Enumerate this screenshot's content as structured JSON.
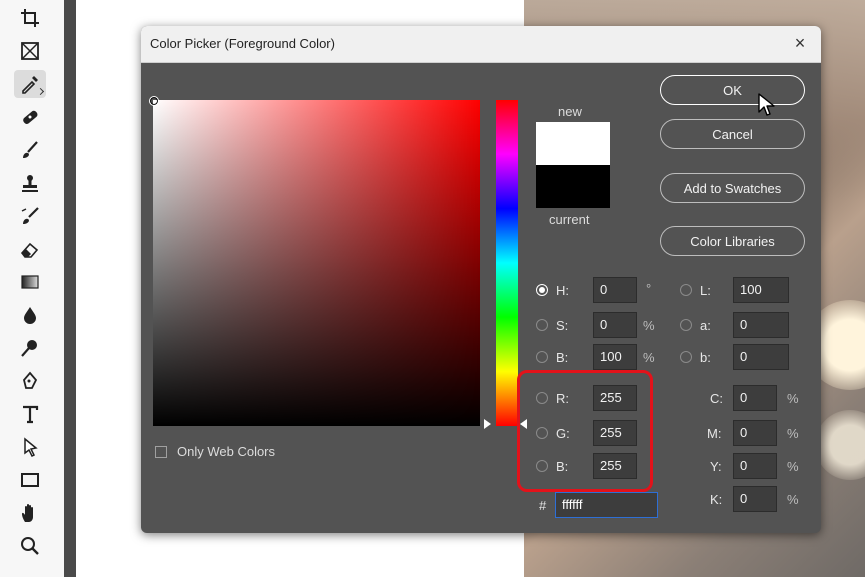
{
  "dialog": {
    "title": "Color Picker (Foreground Color)",
    "close": "×"
  },
  "swatches": {
    "new_label": "new",
    "current_label": "current",
    "new_color": "#ffffff",
    "current_color": "#000000"
  },
  "buttons": {
    "ok": "OK",
    "cancel": "Cancel",
    "add_to_swatches": "Add to Swatches",
    "color_libraries": "Color Libraries"
  },
  "hsb": {
    "h_label": "H:",
    "h_value": "0",
    "h_unit": "°",
    "s_label": "S:",
    "s_value": "0",
    "s_unit": "%",
    "b_label": "B:",
    "b_value": "100",
    "b_unit": "%"
  },
  "lab": {
    "l_label": "L:",
    "l_value": "100",
    "a_label": "a:",
    "a_value": "0",
    "b_label": "b:",
    "b_value": "0"
  },
  "rgb": {
    "r_label": "R:",
    "r_value": "255",
    "g_label": "G:",
    "g_value": "255",
    "b_label": "B:",
    "b_value": "255"
  },
  "cmyk": {
    "c_label": "C:",
    "c_value": "0",
    "c_unit": "%",
    "m_label": "M:",
    "m_value": "0",
    "m_unit": "%",
    "y_label": "Y:",
    "y_value": "0",
    "y_unit": "%",
    "k_label": "K:",
    "k_value": "0",
    "k_unit": "%"
  },
  "hex": {
    "label": "#",
    "value": "ffffff"
  },
  "web_colors": {
    "label": "Only Web Colors"
  },
  "toolbar": {
    "tools": [
      "crop-icon",
      "frame-icon",
      "eyedropper-icon",
      "healing-brush-icon",
      "brush-icon",
      "clone-stamp-icon",
      "history-brush-icon",
      "eraser-icon",
      "gradient-icon",
      "blur-icon",
      "dodge-icon",
      "pen-icon",
      "type-icon",
      "path-selection-icon",
      "rectangle-icon",
      "hand-icon",
      "zoom-icon"
    ]
  },
  "colors": {
    "dialog_bg": "#535353",
    "highlight": "#e3121a",
    "field_hue": "#ff0000"
  }
}
